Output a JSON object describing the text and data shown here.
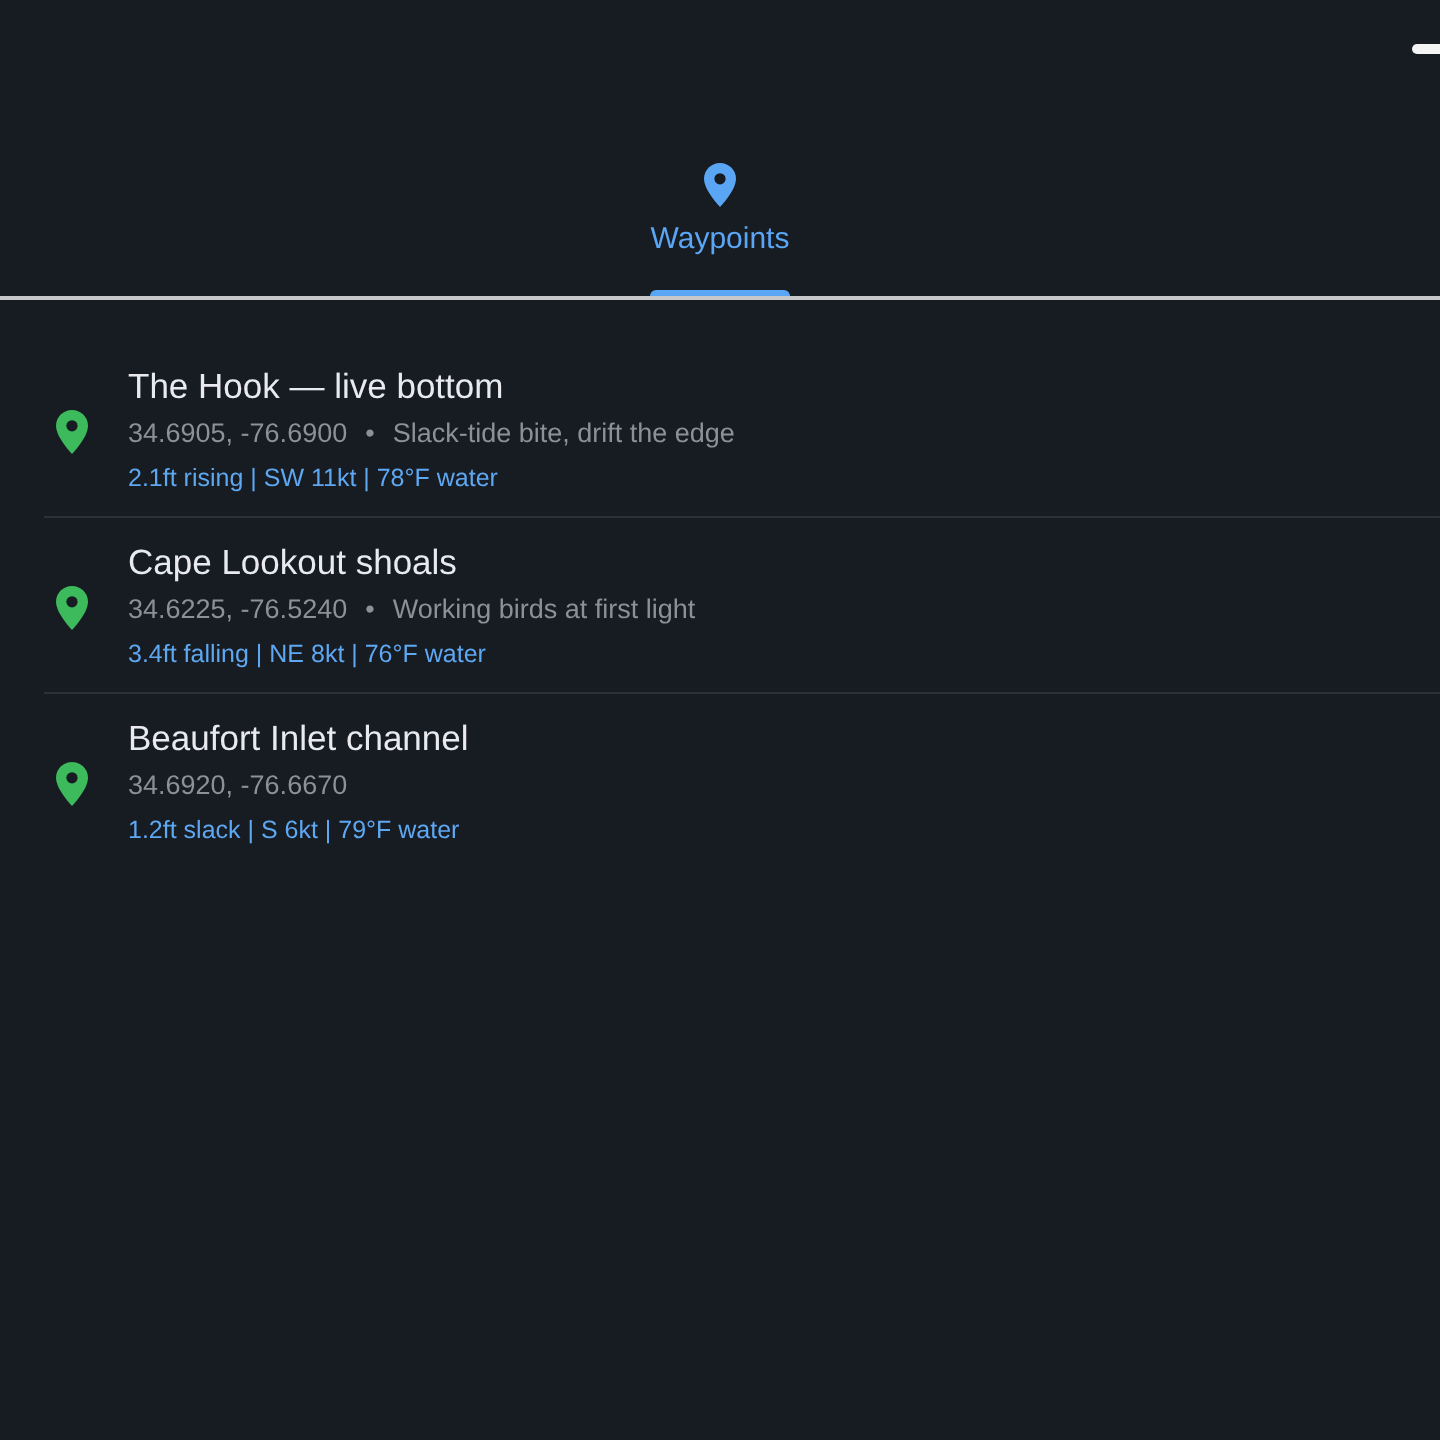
{
  "tabs": [
    {
      "label": "Waypoints",
      "selected": true
    }
  ],
  "waypoints": [
    {
      "name": "The Hook — live bottom",
      "coords": "34.6905, -76.6900",
      "separator": "•",
      "note": "Slack-tide bite, drift the edge",
      "conditions": "2.1ft rising | SW 11kt | 78°F water"
    },
    {
      "name": "Cape Lookout shoals",
      "coords": "34.6225, -76.5240",
      "separator": "•",
      "note": "Working birds at first light",
      "conditions": "3.4ft falling | NE 8kt | 76°F water"
    },
    {
      "name": "Beaufort Inlet channel",
      "coords": "34.6920, -76.6670",
      "conditions": "1.2ft slack | S 6kt | 79°F water"
    }
  ]
}
